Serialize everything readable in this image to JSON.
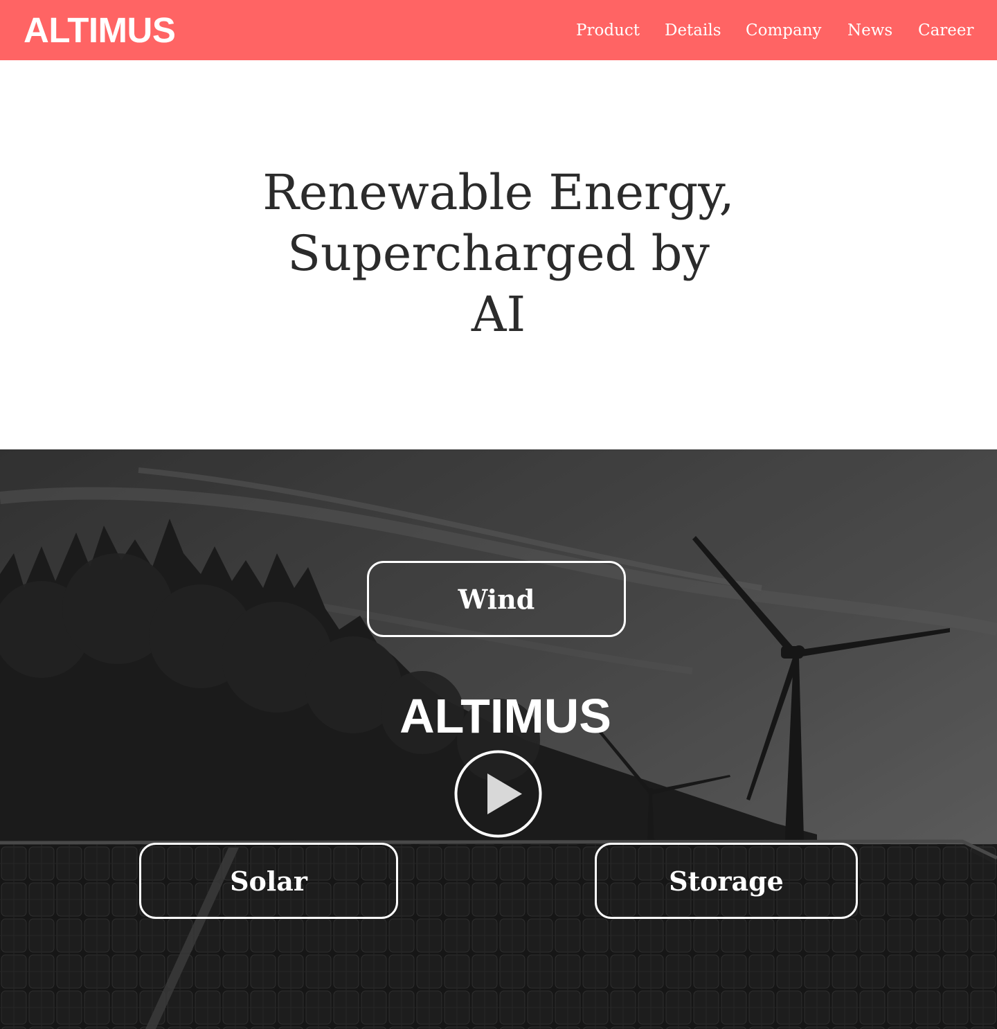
{
  "header": {
    "logo": "ALTIMUS",
    "background_color": "#ff6464",
    "nav": [
      {
        "label": "Product"
      },
      {
        "label": "Details"
      },
      {
        "label": "Company"
      },
      {
        "label": "News"
      },
      {
        "label": "Career"
      }
    ]
  },
  "hero": {
    "headline_lines": [
      "Renewable Energy,",
      "Supercharged by",
      "AI"
    ]
  },
  "media": {
    "brand": "ALTIMUS",
    "play_icon": "play-icon",
    "buttons": {
      "wind": "Wind",
      "solar": "Solar",
      "storage": "Storage"
    }
  }
}
